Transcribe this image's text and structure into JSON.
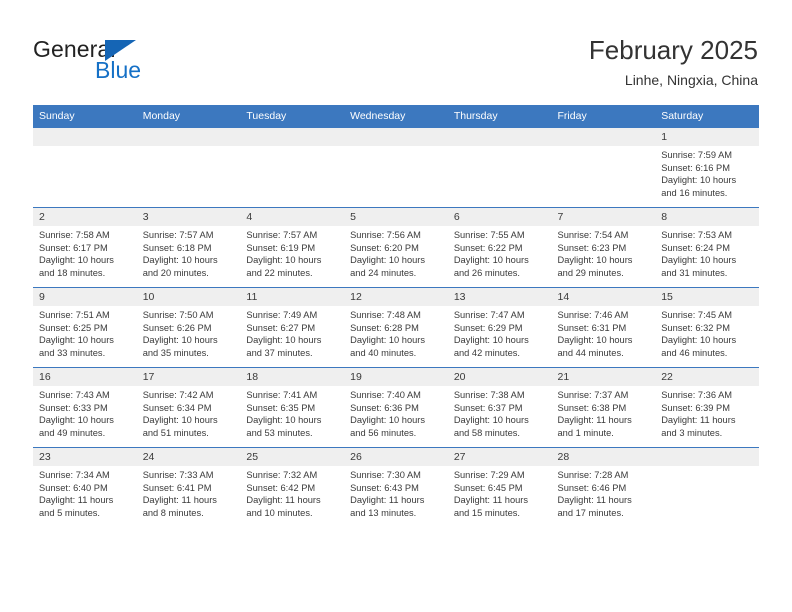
{
  "brand": {
    "name_part1": "General",
    "name_part2": "Blue",
    "triangle_icon": "triangle-icon",
    "accent_color": "#1570c6"
  },
  "header": {
    "title": "February 2025",
    "subtitle": "Linhe, Ningxia, China",
    "header_blue": "#3c78bf",
    "band_gray": "#efefef"
  },
  "weekdays": [
    "Sunday",
    "Monday",
    "Tuesday",
    "Wednesday",
    "Thursday",
    "Friday",
    "Saturday"
  ],
  "weeks": [
    [
      {
        "day": "",
        "lines": []
      },
      {
        "day": "",
        "lines": []
      },
      {
        "day": "",
        "lines": []
      },
      {
        "day": "",
        "lines": []
      },
      {
        "day": "",
        "lines": []
      },
      {
        "day": "",
        "lines": []
      },
      {
        "day": "1",
        "lines": [
          "Sunrise: 7:59 AM",
          "Sunset: 6:16 PM",
          "Daylight: 10 hours",
          "and 16 minutes."
        ]
      }
    ],
    [
      {
        "day": "2",
        "lines": [
          "Sunrise: 7:58 AM",
          "Sunset: 6:17 PM",
          "Daylight: 10 hours",
          "and 18 minutes."
        ]
      },
      {
        "day": "3",
        "lines": [
          "Sunrise: 7:57 AM",
          "Sunset: 6:18 PM",
          "Daylight: 10 hours",
          "and 20 minutes."
        ]
      },
      {
        "day": "4",
        "lines": [
          "Sunrise: 7:57 AM",
          "Sunset: 6:19 PM",
          "Daylight: 10 hours",
          "and 22 minutes."
        ]
      },
      {
        "day": "5",
        "lines": [
          "Sunrise: 7:56 AM",
          "Sunset: 6:20 PM",
          "Daylight: 10 hours",
          "and 24 minutes."
        ]
      },
      {
        "day": "6",
        "lines": [
          "Sunrise: 7:55 AM",
          "Sunset: 6:22 PM",
          "Daylight: 10 hours",
          "and 26 minutes."
        ]
      },
      {
        "day": "7",
        "lines": [
          "Sunrise: 7:54 AM",
          "Sunset: 6:23 PM",
          "Daylight: 10 hours",
          "and 29 minutes."
        ]
      },
      {
        "day": "8",
        "lines": [
          "Sunrise: 7:53 AM",
          "Sunset: 6:24 PM",
          "Daylight: 10 hours",
          "and 31 minutes."
        ]
      }
    ],
    [
      {
        "day": "9",
        "lines": [
          "Sunrise: 7:51 AM",
          "Sunset: 6:25 PM",
          "Daylight: 10 hours",
          "and 33 minutes."
        ]
      },
      {
        "day": "10",
        "lines": [
          "Sunrise: 7:50 AM",
          "Sunset: 6:26 PM",
          "Daylight: 10 hours",
          "and 35 minutes."
        ]
      },
      {
        "day": "11",
        "lines": [
          "Sunrise: 7:49 AM",
          "Sunset: 6:27 PM",
          "Daylight: 10 hours",
          "and 37 minutes."
        ]
      },
      {
        "day": "12",
        "lines": [
          "Sunrise: 7:48 AM",
          "Sunset: 6:28 PM",
          "Daylight: 10 hours",
          "and 40 minutes."
        ]
      },
      {
        "day": "13",
        "lines": [
          "Sunrise: 7:47 AM",
          "Sunset: 6:29 PM",
          "Daylight: 10 hours",
          "and 42 minutes."
        ]
      },
      {
        "day": "14",
        "lines": [
          "Sunrise: 7:46 AM",
          "Sunset: 6:31 PM",
          "Daylight: 10 hours",
          "and 44 minutes."
        ]
      },
      {
        "day": "15",
        "lines": [
          "Sunrise: 7:45 AM",
          "Sunset: 6:32 PM",
          "Daylight: 10 hours",
          "and 46 minutes."
        ]
      }
    ],
    [
      {
        "day": "16",
        "lines": [
          "Sunrise: 7:43 AM",
          "Sunset: 6:33 PM",
          "Daylight: 10 hours",
          "and 49 minutes."
        ]
      },
      {
        "day": "17",
        "lines": [
          "Sunrise: 7:42 AM",
          "Sunset: 6:34 PM",
          "Daylight: 10 hours",
          "and 51 minutes."
        ]
      },
      {
        "day": "18",
        "lines": [
          "Sunrise: 7:41 AM",
          "Sunset: 6:35 PM",
          "Daylight: 10 hours",
          "and 53 minutes."
        ]
      },
      {
        "day": "19",
        "lines": [
          "Sunrise: 7:40 AM",
          "Sunset: 6:36 PM",
          "Daylight: 10 hours",
          "and 56 minutes."
        ]
      },
      {
        "day": "20",
        "lines": [
          "Sunrise: 7:38 AM",
          "Sunset: 6:37 PM",
          "Daylight: 10 hours",
          "and 58 minutes."
        ]
      },
      {
        "day": "21",
        "lines": [
          "Sunrise: 7:37 AM",
          "Sunset: 6:38 PM",
          "Daylight: 11 hours",
          "and 1 minute."
        ]
      },
      {
        "day": "22",
        "lines": [
          "Sunrise: 7:36 AM",
          "Sunset: 6:39 PM",
          "Daylight: 11 hours",
          "and 3 minutes."
        ]
      }
    ],
    [
      {
        "day": "23",
        "lines": [
          "Sunrise: 7:34 AM",
          "Sunset: 6:40 PM",
          "Daylight: 11 hours",
          "and 5 minutes."
        ]
      },
      {
        "day": "24",
        "lines": [
          "Sunrise: 7:33 AM",
          "Sunset: 6:41 PM",
          "Daylight: 11 hours",
          "and 8 minutes."
        ]
      },
      {
        "day": "25",
        "lines": [
          "Sunrise: 7:32 AM",
          "Sunset: 6:42 PM",
          "Daylight: 11 hours",
          "and 10 minutes."
        ]
      },
      {
        "day": "26",
        "lines": [
          "Sunrise: 7:30 AM",
          "Sunset: 6:43 PM",
          "Daylight: 11 hours",
          "and 13 minutes."
        ]
      },
      {
        "day": "27",
        "lines": [
          "Sunrise: 7:29 AM",
          "Sunset: 6:45 PM",
          "Daylight: 11 hours",
          "and 15 minutes."
        ]
      },
      {
        "day": "28",
        "lines": [
          "Sunrise: 7:28 AM",
          "Sunset: 6:46 PM",
          "Daylight: 11 hours",
          "and 17 minutes."
        ]
      },
      {
        "day": "",
        "lines": []
      }
    ]
  ]
}
